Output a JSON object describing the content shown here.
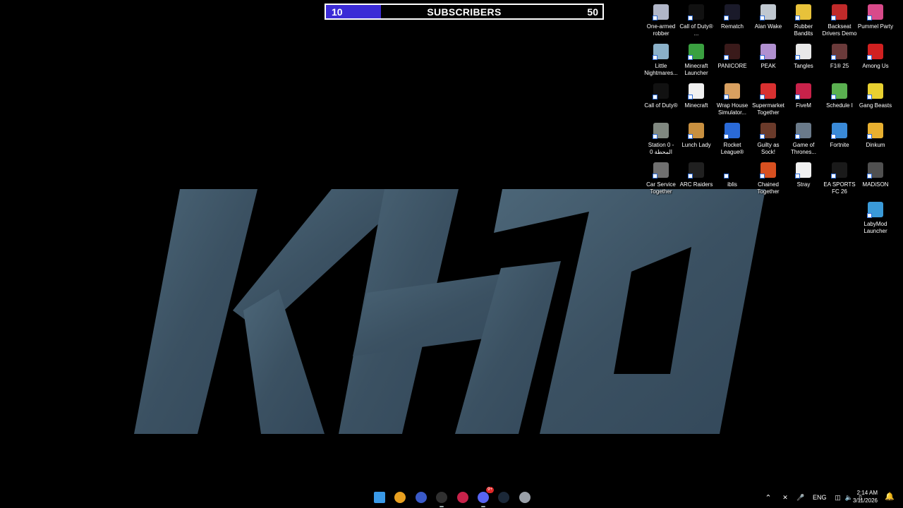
{
  "subscriber_goal": {
    "current": "10",
    "title": "SUBSCRIBERS",
    "goal": "50",
    "progress_fraction": 0.2,
    "fill_color": "#3b2bd6"
  },
  "wallpaper": {
    "logo_text": "KHD",
    "color": "#3f5566"
  },
  "desktop_icons": [
    {
      "label": "One-armed robber",
      "color": "#b0b6c8",
      "icon": "robber-icon"
    },
    {
      "label": "Call of Duty® ...",
      "color": "#111111",
      "icon": "cod-icon"
    },
    {
      "label": "Rematch",
      "color": "#1a1a2a",
      "icon": "rematch-icon"
    },
    {
      "label": "Alan Wake",
      "color": "#c0c8d0",
      "icon": "alan-wake-icon"
    },
    {
      "label": "Rubber Bandits",
      "color": "#e8c23a",
      "icon": "rubber-bandits-icon"
    },
    {
      "label": "Backseat Drivers Demo",
      "color": "#c02a2a",
      "icon": "backseat-drivers-icon"
    },
    {
      "label": "Pummel Party",
      "color": "#d84a8a",
      "icon": "pummel-party-icon"
    },
    {
      "label": "Little Nightmares...",
      "color": "#8ab0c8",
      "icon": "little-nightmares-icon"
    },
    {
      "label": "Minecraft Launcher",
      "color": "#3aa040",
      "icon": "minecraft-launcher-icon"
    },
    {
      "label": "PANICORE",
      "color": "#3a1a1a",
      "icon": "panicore-icon"
    },
    {
      "label": "PEAK",
      "color": "#b090d0",
      "icon": "peak-icon"
    },
    {
      "label": "Tangles",
      "color": "#e8e8e8",
      "icon": "tangles-icon"
    },
    {
      "label": "F1® 25",
      "color": "#6a3a3a",
      "icon": "f1-icon"
    },
    {
      "label": "Among Us",
      "color": "#d02020",
      "icon": "among-us-icon"
    },
    {
      "label": "Call of Duty®",
      "color": "#111111",
      "icon": "cod2-icon"
    },
    {
      "label": "Minecraft",
      "color": "#f0f0f0",
      "icon": "file-icon"
    },
    {
      "label": "Wrap House Simulator...",
      "color": "#d8a060",
      "icon": "wrap-house-icon"
    },
    {
      "label": "Supermarket Together",
      "color": "#d83030",
      "icon": "supermarket-icon"
    },
    {
      "label": "FiveM",
      "color": "#c8224a",
      "icon": "fivem-icon"
    },
    {
      "label": "Schedule I",
      "color": "#5ab050",
      "icon": "schedule-icon"
    },
    {
      "label": "Gang Beasts",
      "color": "#e8d030",
      "icon": "gang-beasts-icon"
    },
    {
      "label": "Station 0 - المحطة 0",
      "color": "#808880",
      "icon": "station0-icon"
    },
    {
      "label": "Lunch Lady",
      "color": "#c89040",
      "icon": "lunch-lady-icon"
    },
    {
      "label": "Rocket League®",
      "color": "#2a6ad8",
      "icon": "rocket-league-icon"
    },
    {
      "label": "Guilty as Sock!",
      "color": "#6a3a2a",
      "icon": "guilty-sock-icon"
    },
    {
      "label": "Game of Thrones...",
      "color": "#6a7a8a",
      "icon": "got-icon"
    },
    {
      "label": "Fortnite",
      "color": "#3a8ad8",
      "icon": "fortnite-icon"
    },
    {
      "label": "Dinkum",
      "color": "#e8b030",
      "icon": "dinkum-icon"
    },
    {
      "label": "Car Service Together",
      "color": "#707070",
      "icon": "car-service-icon"
    },
    {
      "label": "ARC Raiders",
      "color": "#202020",
      "icon": "arc-raiders-icon"
    },
    {
      "label": "iblis",
      "color": "#000000",
      "icon": "iblis-icon"
    },
    {
      "label": "Chained Together",
      "color": "#d85020",
      "icon": "chained-icon"
    },
    {
      "label": "Stray",
      "color": "#f0f0f0",
      "icon": "stray-icon"
    },
    {
      "label": "EA SPORTS FC 26",
      "color": "#1a1a1a",
      "icon": "ea-fc-icon"
    },
    {
      "label": "MADiSON",
      "color": "#505050",
      "icon": "madison-icon"
    },
    {
      "label": "LabyMod Launcher",
      "color": "#3a9ad8",
      "icon": "labymod-icon"
    }
  ],
  "taskbar": {
    "apps": [
      {
        "name": "start-button",
        "color": "#3a9ae8"
      },
      {
        "name": "chrome-icon",
        "color": "#e8a020"
      },
      {
        "name": "gsp-icon",
        "color": "#3a5ac8"
      },
      {
        "name": "obs-icon",
        "color": "#303030"
      },
      {
        "name": "fivem-taskbar-icon",
        "color": "#c8224a"
      },
      {
        "name": "discord-icon",
        "color": "#5865f2"
      },
      {
        "name": "steam-icon",
        "color": "#1b2838"
      },
      {
        "name": "settings-icon",
        "color": "#9aa0a8"
      }
    ],
    "discord_badge": "9+",
    "language": "ENG",
    "time": "2:14 AM",
    "date": "3/11/2026"
  }
}
